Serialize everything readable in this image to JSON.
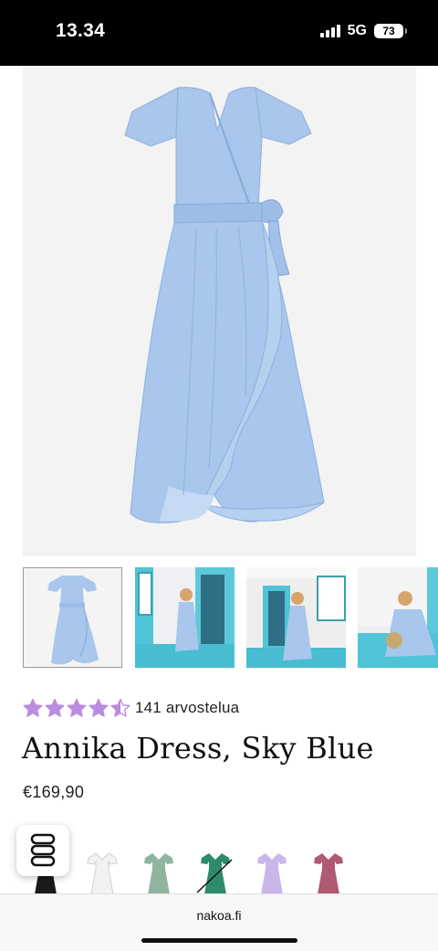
{
  "status_bar": {
    "time": "13.34",
    "network": "5G",
    "battery": "73"
  },
  "product": {
    "rating_value": 4.5,
    "rating_max": 5,
    "star_color": "#b98de0",
    "review_count": "141 arvostelua",
    "title": "Annika Dress, Sky Blue",
    "price": "€169,90",
    "dress_color": "#a9c6ec"
  },
  "thumbnails": [
    {
      "name": "front-view",
      "selected": true
    },
    {
      "name": "model-doorway",
      "selected": false
    },
    {
      "name": "model-wall",
      "selected": false
    },
    {
      "name": "model-sitting",
      "selected": false
    }
  ],
  "swatches": [
    {
      "name": "black",
      "color": "#1a1a1a"
    },
    {
      "name": "white",
      "color": "#f2f2f0"
    },
    {
      "name": "sage",
      "color": "#8fb5a0"
    },
    {
      "name": "green",
      "color": "#2f8a6c",
      "sold_out": true
    },
    {
      "name": "lilac",
      "color": "#c9b6ea"
    },
    {
      "name": "rose",
      "color": "#b05a72"
    }
  ],
  "browser": {
    "url": "nakoa.fi"
  }
}
